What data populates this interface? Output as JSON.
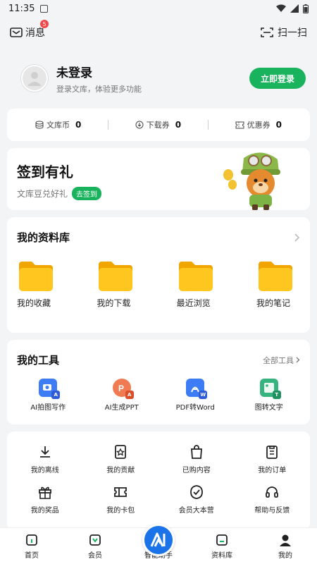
{
  "status": {
    "time": "11:35"
  },
  "topbar": {
    "messages_label": "消息",
    "messages_badge": "5",
    "scan_label": "扫一扫"
  },
  "profile": {
    "name": "未登录",
    "subtitle": "登录文库，体验更多功能",
    "login_button": "立即登录"
  },
  "stats": [
    {
      "label": "文库币",
      "value": "0",
      "icon": "coin-stack-icon"
    },
    {
      "label": "下载券",
      "value": "0",
      "icon": "download-circle-icon"
    },
    {
      "label": "优惠券",
      "value": "0",
      "icon": "ticket-icon"
    }
  ],
  "signin": {
    "title": "签到有礼",
    "subtitle": "文库豆兑好礼",
    "button": "去签到"
  },
  "library": {
    "title": "我的资料库",
    "items": [
      {
        "label": "我的收藏"
      },
      {
        "label": "我的下载"
      },
      {
        "label": "最近浏览"
      },
      {
        "label": "我的笔记"
      }
    ]
  },
  "tools": {
    "title": "我的工具",
    "more": "全部工具",
    "items": [
      {
        "label": "AI拍图写作",
        "color": "#3d7cf5",
        "mini": "A",
        "mini_color": "#2f5bd8"
      },
      {
        "label": "AI生成PPT",
        "color": "#f07a52",
        "mini": "A",
        "mini_color": "#d94f2a"
      },
      {
        "label": "PDF转Word",
        "color": "#3d7cf5",
        "mini": "W",
        "mini_color": "#2f5bd8"
      },
      {
        "label": "图转文字",
        "color": "#36b37e",
        "mini": "T",
        "mini_color": "#1f9160"
      }
    ]
  },
  "services": {
    "row1": [
      {
        "label": "我的离线",
        "icon": "offline-download-icon"
      },
      {
        "label": "我的贡献",
        "icon": "contribution-icon"
      },
      {
        "label": "已购内容",
        "icon": "purchased-bag-icon"
      },
      {
        "label": "我的订单",
        "icon": "order-clipboard-icon"
      }
    ],
    "row2": [
      {
        "label": "我的奖品",
        "icon": "gift-icon"
      },
      {
        "label": "我的卡包",
        "icon": "card-pack-icon"
      },
      {
        "label": "会员大本营",
        "icon": "member-camp-icon"
      },
      {
        "label": "帮助与反馈",
        "icon": "headset-icon"
      }
    ]
  },
  "tabbar": [
    {
      "label": "首页"
    },
    {
      "label": "会员"
    },
    {
      "label": "智能助手"
    },
    {
      "label": "资料库"
    },
    {
      "label": "我的"
    }
  ],
  "colors": {
    "accent": "#19b35d",
    "assistant": "#1a73e8",
    "folder": "#ffc61f"
  }
}
